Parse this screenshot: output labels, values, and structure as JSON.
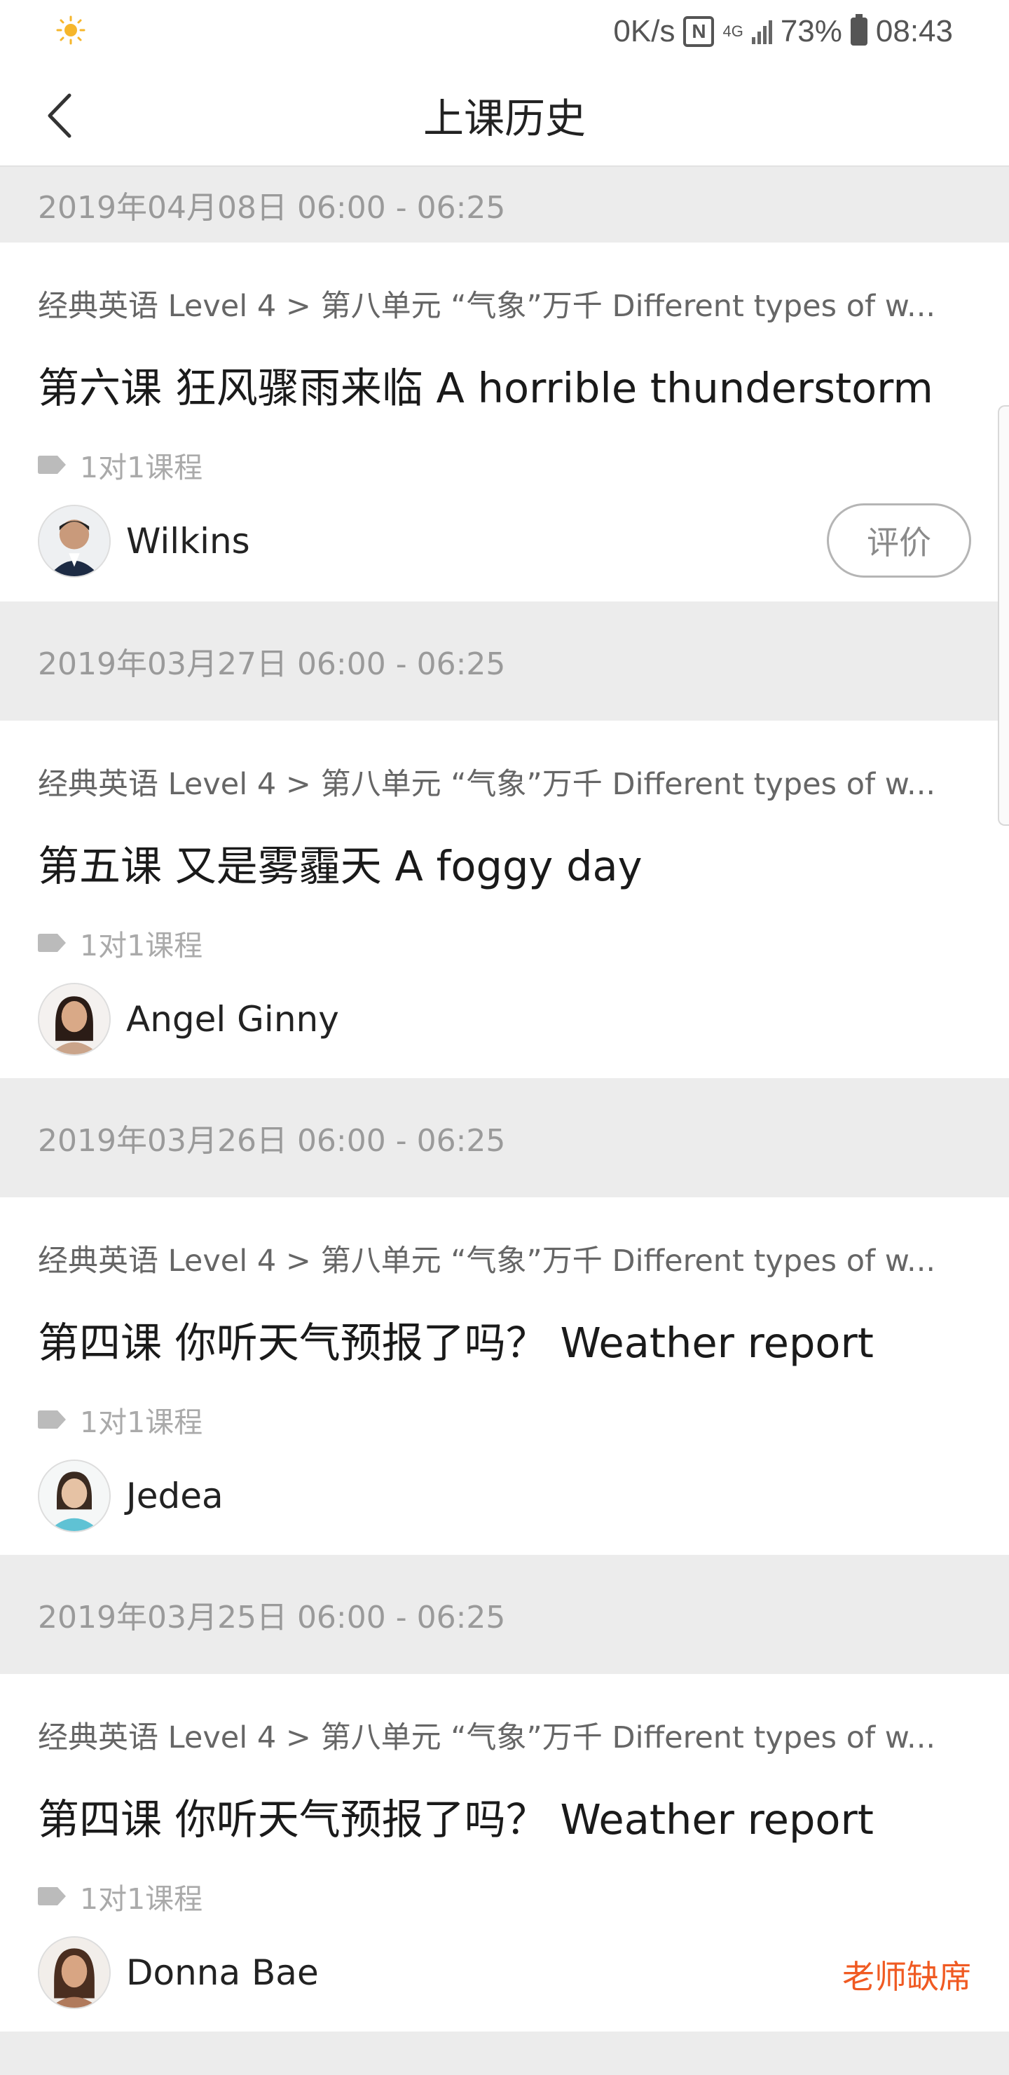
{
  "status_bar": {
    "net_speed": "0K/s",
    "nfc_letter": "N",
    "network_type": "4G",
    "battery": "73%",
    "time": "08:43",
    "weather_icon": "sun-icon"
  },
  "nav": {
    "title": "上课历史",
    "back_icon": "chevron-left-icon"
  },
  "sessions": [
    {
      "date": "2019年04月08日 06:00 - 06:25",
      "course_path": "经典英语 Level 4 > 第八单元 “气象”万千 Different types of w...",
      "lesson_title": "第六课 狂风骤雨来临 A horrible thunderstorm",
      "tag": "1对1课程",
      "teacher": "Wilkins",
      "action_label": "评价"
    },
    {
      "date": "2019年03月27日 06:00 - 06:25",
      "course_path": "经典英语 Level 4 > 第八单元 “气象”万千 Different types of w...",
      "lesson_title": "第五课 又是雾霾天 A foggy day",
      "tag": "1对1课程",
      "teacher": "Angel Ginny"
    },
    {
      "date": "2019年03月26日 06:00 - 06:25",
      "course_path": "经典英语 Level 4 > 第八单元 “气象”万千 Different types of w...",
      "lesson_title": "第四课 你听天气预报了吗？ Weather report",
      "tag": "1对1课程",
      "teacher": "Jedea"
    },
    {
      "date": "2019年03月25日 06:00 - 06:25",
      "course_path": "经典英语 Level 4 > 第八单元 “气象”万千 Different types of w...",
      "lesson_title": "第四课 你听天气预报了吗？ Weather report",
      "tag": "1对1课程",
      "teacher": "Donna Bae",
      "status_label": "老师缺席"
    }
  ],
  "colors": {
    "accent_absent": "#f05a22",
    "background": "#ececec",
    "card": "#ffffff"
  }
}
